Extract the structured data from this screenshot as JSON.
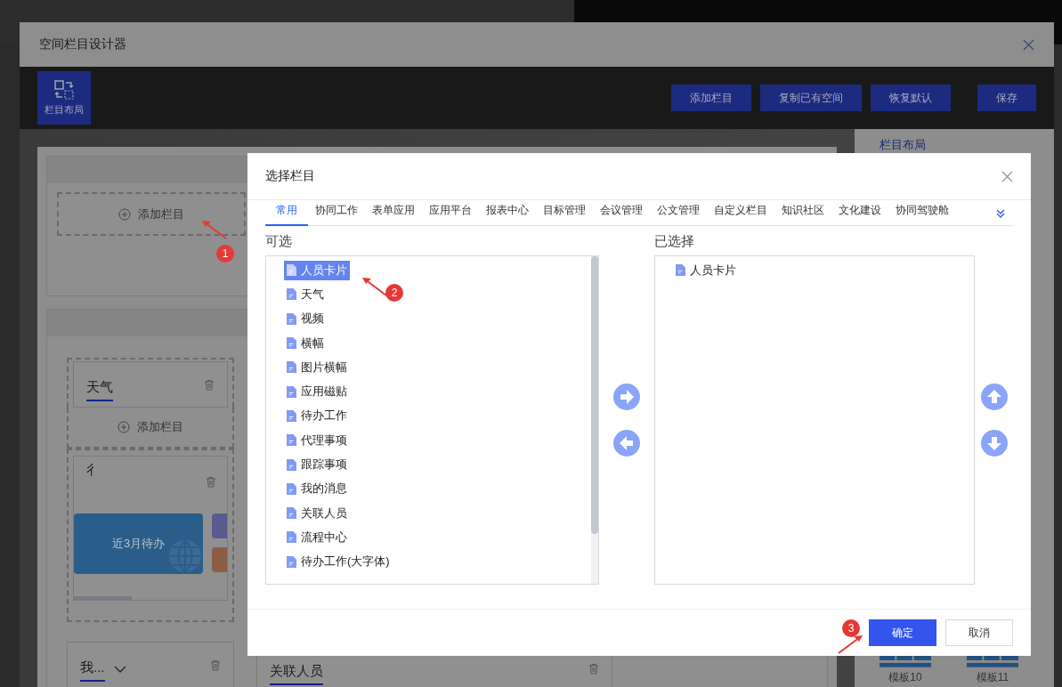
{
  "designer": {
    "title": "空间栏目设计器",
    "layout_tab": {
      "label": "栏目布局",
      "selected": true
    },
    "buttons": [
      "添加栏目",
      "复制已有空间",
      "恢复默认",
      "保存"
    ],
    "canvas": {
      "top_add": "添加栏目",
      "items": [
        {
          "kind": "card",
          "title": "天气"
        },
        {
          "kind": "add",
          "label": "添加栏目"
        },
        {
          "kind": "tiles",
          "title": "彳",
          "tile": "近3月待办"
        },
        {
          "kind": "dropdown",
          "title": "我..."
        }
      ],
      "middle_card": "关联人员"
    },
    "side_panel": {
      "title": "栏目布局",
      "templates": [
        "模板10",
        "模板11"
      ]
    }
  },
  "dialog": {
    "title": "选择栏目",
    "tabs": [
      {
        "label": "常用",
        "selected": true
      },
      {
        "label": "协同工作",
        "selected": false
      },
      {
        "label": "表单应用",
        "selected": false
      },
      {
        "label": "应用平台",
        "selected": false
      },
      {
        "label": "报表中心",
        "selected": false
      },
      {
        "label": "目标管理",
        "selected": false
      },
      {
        "label": "会议管理",
        "selected": false
      },
      {
        "label": "公文管理",
        "selected": false
      },
      {
        "label": "自定义栏目",
        "selected": false
      },
      {
        "label": "知识社区",
        "selected": false
      },
      {
        "label": "文化建设",
        "selected": false
      },
      {
        "label": "协同驾驶舱",
        "selected": false
      }
    ],
    "available_label": "可选",
    "chosen_label": "已选择",
    "available": [
      {
        "label": "人员卡片",
        "selected": true
      },
      {
        "label": "天气",
        "selected": false
      },
      {
        "label": "视频",
        "selected": false
      },
      {
        "label": "横幅",
        "selected": false
      },
      {
        "label": "图片横幅",
        "selected": false
      },
      {
        "label": "应用磁贴",
        "selected": false
      },
      {
        "label": "待办工作",
        "selected": false
      },
      {
        "label": "代理事项",
        "selected": false
      },
      {
        "label": "跟踪事项",
        "selected": false
      },
      {
        "label": "我的消息",
        "selected": false
      },
      {
        "label": "关联人员",
        "selected": false
      },
      {
        "label": "流程中心",
        "selected": false
      },
      {
        "label": "待办工作(大字体)",
        "selected": false
      }
    ],
    "chosen": [
      "人员卡片"
    ],
    "ok": "确定",
    "cancel": "取消"
  },
  "annotations": [
    "1",
    "2",
    "3"
  ]
}
